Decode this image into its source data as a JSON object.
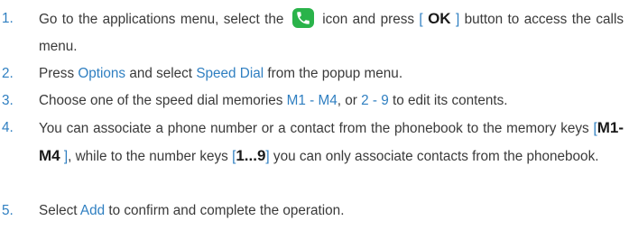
{
  "steps": [
    {
      "number": "1.",
      "p1": "Go to the applications menu, select the",
      "icon": "phone-call-icon",
      "p2": "icon and press",
      "bracket_open": "[",
      "key": "OK",
      "bracket_close": "]",
      "p3": "button to access the calls menu."
    },
    {
      "number": "2.",
      "p1": "Press",
      "link1": "Options",
      "p2": "and select",
      "link2": "Speed Dial",
      "p3": "from the popup menu."
    },
    {
      "number": "3.",
      "p1": "Choose one of the speed dial memories",
      "link1": "M1 - M4",
      "p2": ", or",
      "link2": "2 - 9",
      "p3": "to edit its contents."
    },
    {
      "number": "4.",
      "p1": "You can associate a phone number or a contact from the phonebook to the memory keys",
      "b1_open": "[",
      "key1": "M1",
      "dash": "-",
      "key2": "M4",
      "b1_close": "]",
      "p2": ", while to the number keys",
      "b2_open": "[",
      "key3": "1...9",
      "b2_close": "]",
      "p3": "you can only associate contacts from the phonebook."
    },
    {
      "number": "5.",
      "p1": "Select",
      "link1": "Add",
      "p2": "to confirm and complete the operation."
    }
  ],
  "colors": {
    "accent": "#2f7fc1",
    "icon_bg": "#2ab34a",
    "text": "#3a3a3a"
  }
}
